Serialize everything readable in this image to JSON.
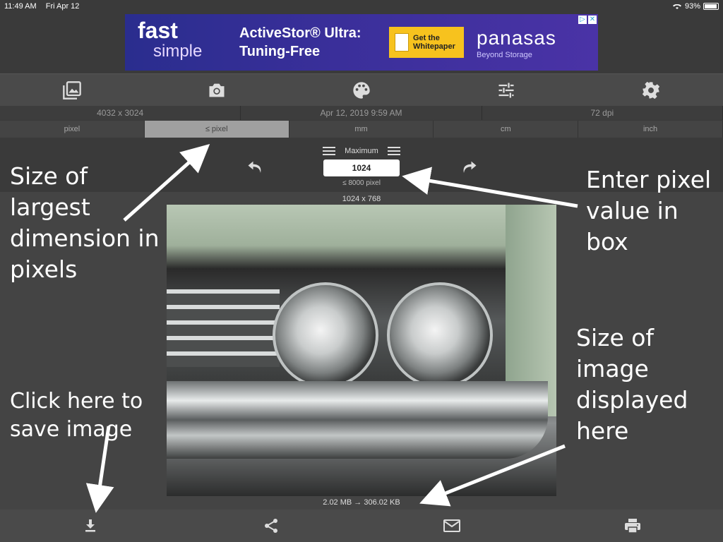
{
  "status_bar": {
    "time": "11:49 AM",
    "date": "Fri Apr 12",
    "battery": "93%"
  },
  "ad": {
    "brand_line1": "fast",
    "brand_line2": "simple",
    "headline_line1": "ActiveStor® Ultra:",
    "headline_line2": "Tuning-Free",
    "cta_line1": "Get the",
    "cta_line2": "Whitepaper",
    "logo": "panasas",
    "logo_sub": "Beyond Storage"
  },
  "toolbar": {
    "icons": [
      "gallery-icon",
      "camera-icon",
      "palette-icon",
      "sliders-icon",
      "gear-icon"
    ]
  },
  "info": {
    "dimensions": "4032 x 3024",
    "date": "Apr 12, 2019 9:59 AM",
    "dpi": "72 dpi"
  },
  "units": {
    "items": [
      "pixel",
      "≤ pixel",
      "mm",
      "cm",
      "inch"
    ],
    "selected": "≤ pixel"
  },
  "control": {
    "mode_label": "Maximum",
    "value": "1024",
    "range_note": "≤ 8000 pixel"
  },
  "image": {
    "display_dims": "1024 x 768",
    "size_change": "2.02 MB → 306.02 KB"
  },
  "bottom_bar": {
    "icons": [
      "download-icon",
      "share-icon",
      "mail-icon",
      "print-icon"
    ]
  },
  "annotations": {
    "largest_dimension": "Size of largest dimension in pixels",
    "enter_value": "Enter pixel value in box",
    "image_size": "Size of image displayed here",
    "save_image": "Click here to save image"
  },
  "colors": {
    "background": "#3a3a3a",
    "toolbar": "#4a4a4a",
    "selected_unit": "#a0a0a0",
    "ad_cta": "#f7c21e"
  }
}
